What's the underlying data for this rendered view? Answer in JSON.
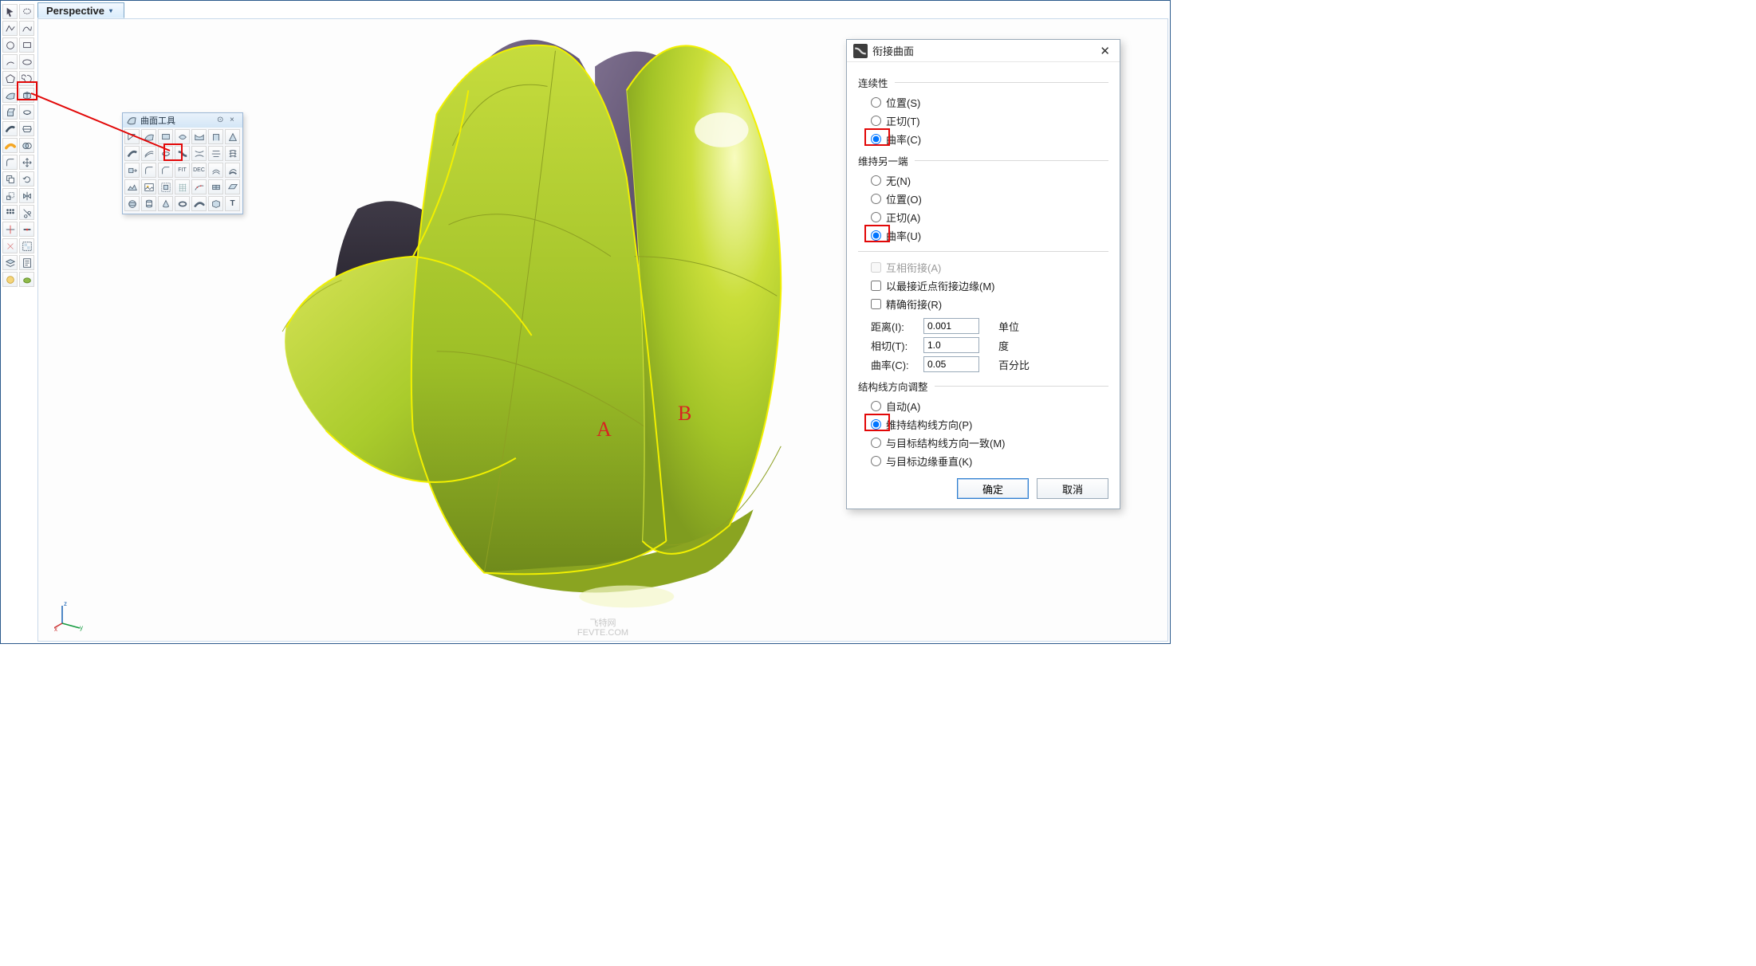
{
  "viewport": {
    "tab_label": "Perspective"
  },
  "axis": {
    "x": "x",
    "y": "y",
    "z": "z"
  },
  "surface_palette": {
    "title": "曲面工具"
  },
  "annotations": {
    "labelA": "A",
    "labelB": "B"
  },
  "watermark": {
    "line1": "飞特网",
    "line2": "FEVTE.COM"
  },
  "dialog": {
    "title": "衔接曲面",
    "group_continuity": "连续性",
    "opt_position_s": "位置(S)",
    "opt_tangent_t": "正切(T)",
    "opt_curvature_c": "曲率(C)",
    "group_preserve": "维持另一端",
    "opt_none_n": "无(N)",
    "opt_position_o": "位置(O)",
    "opt_tangent_a": "正切(A)",
    "opt_curvature_u": "曲率(U)",
    "chk_mutual_a": "互相衔接(A)",
    "chk_nearest_m": "以最接近点衔接边缘(M)",
    "chk_refine_r": "精确衔接(R)",
    "row_distance_label": "距离(I):",
    "row_distance_value": "0.001",
    "row_distance_unit": "单位",
    "row_tangent_label": "相切(T):",
    "row_tangent_value": "1.0",
    "row_tangent_unit": "度",
    "row_curvature_label": "曲率(C):",
    "row_curvature_value": "0.05",
    "row_curvature_unit": "百分比",
    "group_iso": "结构线方向调整",
    "iso_auto_a": "自动(A)",
    "iso_preserve_p": "维持结构线方向(P)",
    "iso_target_m": "与目标结构线方向一致(M)",
    "iso_perp_k": "与目标边缘垂直(K)",
    "btn_ok": "确定",
    "btn_cancel": "取消"
  },
  "toolbar_icons": [
    "pointer-icon",
    "lasso-icon",
    "polyline-icon",
    "curve-freeform-icon",
    "circle-icon",
    "rectangle-icon",
    "arc-icon",
    "ellipse-icon",
    "polygon-icon",
    "spiral-icon",
    "text-icon",
    "dimension-icon",
    "surface-from-curves-icon",
    "solid-box-icon",
    "extrude-icon",
    "revolve-icon",
    "sweep-icon",
    "loft-icon",
    "pipe-icon",
    "boolean-icon",
    "fillet-icon",
    "transform-icon",
    "copy-icon",
    "rotate-icon",
    "scale-icon",
    "mirror-icon",
    "array-icon",
    "trim-icon",
    "split-icon",
    "join-icon",
    "explode-icon",
    "group-icon",
    "layer-icon",
    "properties-icon",
    "render-icon",
    "grasshopper-icon"
  ],
  "palette_icons": [
    "srf-corner-icon",
    "srf-edge-icon",
    "srf-planar-icon",
    "srf-patch-icon",
    "srf-drape-icon",
    "srf-extcrv-icon",
    "srf-extpt-icon",
    "srf-sweep1-icon",
    "srf-sweep2-icon",
    "srf-revolve-icon",
    "srf-blend-icon",
    "srf-rail-icon",
    "srf-loft-icon",
    "srf-network-icon",
    "srf-extend-icon",
    "srf-fillet-icon",
    "srf-chamfer-icon",
    "srf-fit-icon",
    "srf-dec-icon",
    "srf-offset-icon",
    "srf-variable-icon",
    "srf-heightfield-icon",
    "srf-picture-icon",
    "srf-shrink-icon",
    "srf-rebuild-icon",
    "srf-change-icon",
    "srf-refit-icon",
    "srf-plane-icon",
    "srf-sphere-icon",
    "srf-cyl-icon",
    "srf-cone-icon",
    "srf-torus-icon",
    "srf-tube-icon",
    "srf-box-icon",
    "srf-text-icon"
  ]
}
